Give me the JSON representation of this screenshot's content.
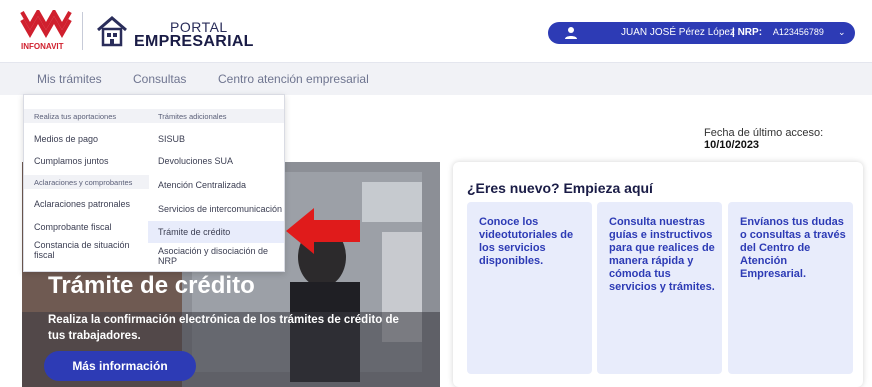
{
  "header": {
    "logo_text": "INFONAVIT",
    "portal_word": "PORTAL",
    "empresarial_word": "EMPRESARIAL",
    "user_name": "JUAN JOSÉ Pérez López",
    "nrp_label": "| NRP:",
    "nrp_value": "A123456789"
  },
  "nav": {
    "items": [
      "Mis trámites",
      "Consultas",
      "Centro atención empresarial"
    ]
  },
  "dropdown": {
    "left_column": {
      "header1": "Realiza tus aportaciones",
      "items1": [
        "Medios de pago",
        "Cumplamos juntos"
      ],
      "header2": "Aclaraciones y comprobantes",
      "items2": [
        "Aclaraciones patronales",
        "Comprobante fiscal",
        "Constancia de situación fiscal"
      ]
    },
    "right_column": {
      "header": "Trámites adicionales",
      "items": [
        "SISUB",
        "Devoluciones SUA",
        "Atención Centralizada",
        "Servicios de intercomunicación",
        "Trámite de crédito",
        "Asociación y disociación de NRP"
      ]
    }
  },
  "last_access": {
    "label": "Fecha de último acceso:",
    "date": "10/10/2023"
  },
  "hero": {
    "title": "Trámite de crédito",
    "description": "Realiza la confirmación electrónica de los trámites de crédito de tus trabajadores.",
    "button": "Más información"
  },
  "new_user": {
    "title": "¿Eres nuevo? Empieza aquí",
    "tiles": [
      "Conoce los videotutoriales de los servicios disponibles.",
      "Consulta nuestras guías e instructivos para que realices de manera rápida y cómoda tus servicios y trámites.",
      "Envíanos tus dudas o consultas a través del Centro de Atención Empresarial."
    ]
  },
  "colors": {
    "accent": "#2d3bb5",
    "infonavit_red": "#d0202e",
    "arrow_red": "#e01b1b"
  }
}
